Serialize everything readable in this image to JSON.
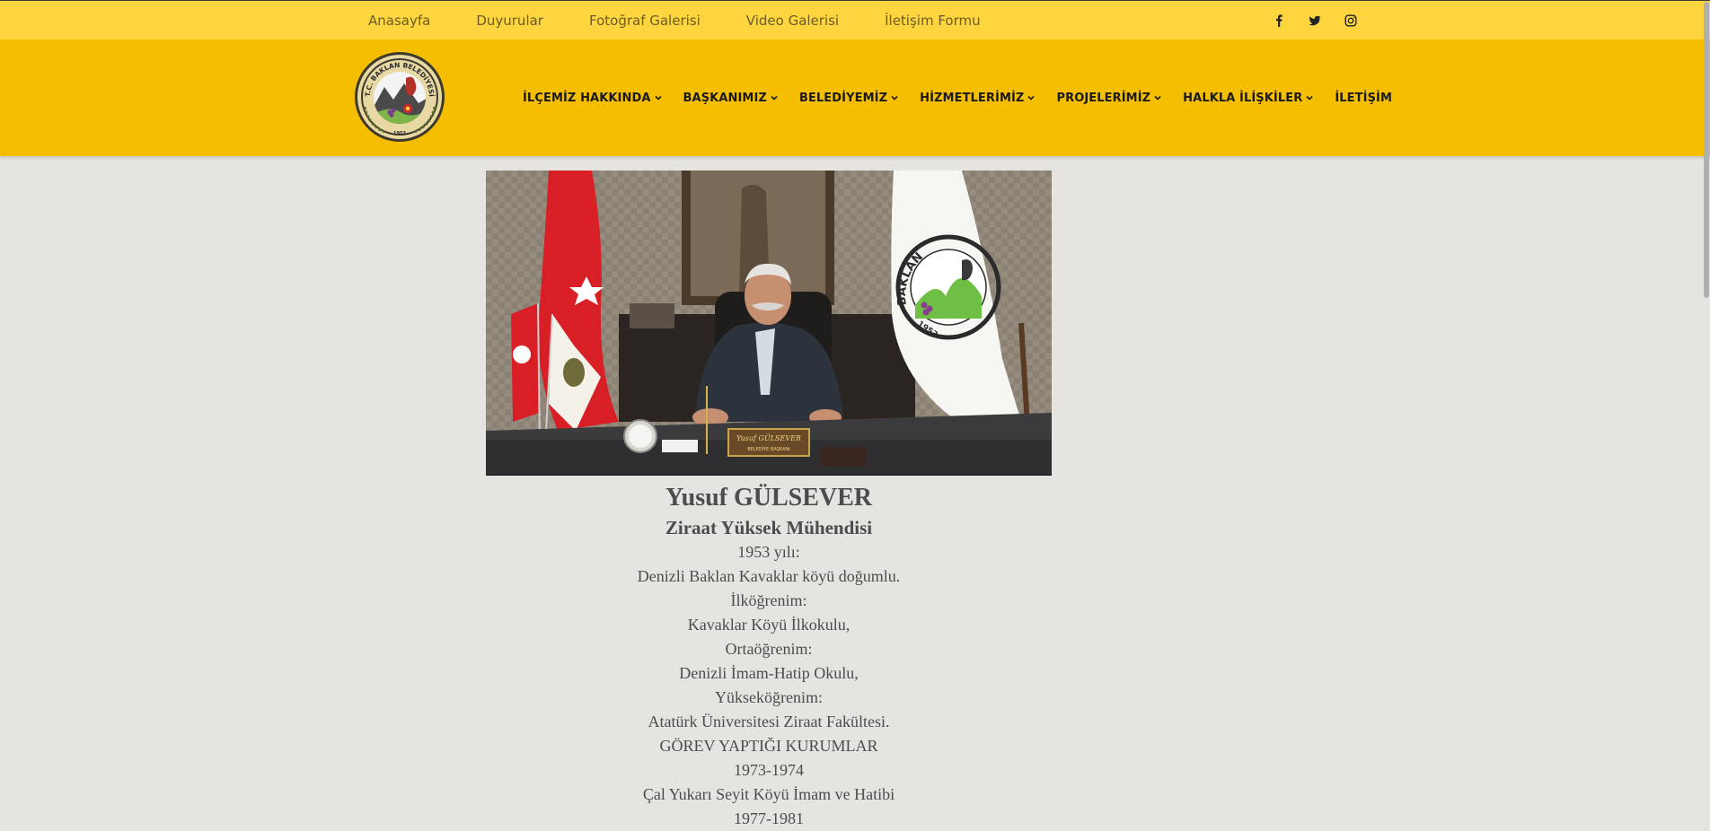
{
  "topbar": {
    "links": [
      "Anasayfa",
      "Duyurular",
      "Fotoğraf Galerisi",
      "Video Galerisi",
      "İletişim Formu"
    ],
    "social_icons": [
      "facebook-icon",
      "twitter-icon",
      "instagram-icon"
    ]
  },
  "logo": {
    "text_top": "T.C. BAKLAN BELEDİYESİ",
    "year": "1953"
  },
  "nav": {
    "items": [
      {
        "label": "İLÇEMİZ HAKKINDA",
        "dropdown": true
      },
      {
        "label": "BAŞKANIMIZ",
        "dropdown": true
      },
      {
        "label": "BELEDİYEMİZ",
        "dropdown": true
      },
      {
        "label": "HİZMETLERİMİZ",
        "dropdown": true
      },
      {
        "label": "PROJELERİMİZ",
        "dropdown": true
      },
      {
        "label": "HALKLA İLİŞKİLER",
        "dropdown": true
      },
      {
        "label": "İLETİŞİM",
        "dropdown": false
      }
    ]
  },
  "photo": {
    "nameplate": "Yusuf GÜLSEVER",
    "nameplate_sub": "BELEDİYE BAŞKANI",
    "flag_text": "BAKLAN",
    "flag_year": "1953"
  },
  "profile": {
    "name": "Yusuf GÜLSEVER",
    "title": "Ziraat Yüksek Mühendisi",
    "lines": [
      "1953 yılı:",
      "Denizli Baklan Kavaklar köyü doğumlu.",
      "İlköğrenim:",
      "Kavaklar Köyü İlkokulu,",
      "Ortaöğrenim:",
      "Denizli İmam-Hatip Okulu,",
      "Yükseköğrenim:",
      "Atatürk Üniversitesi Ziraat Fakültesi.",
      "GÖREV YAPTIĞI KURUMLAR",
      "1973-1974",
      "Çal Yukarı Seyit Köyü İmam ve Hatibi",
      "1977-1981"
    ]
  },
  "colors": {
    "topbar": "#fdd63f",
    "navbar": "#f5bf00",
    "background": "#e5e4e1"
  }
}
